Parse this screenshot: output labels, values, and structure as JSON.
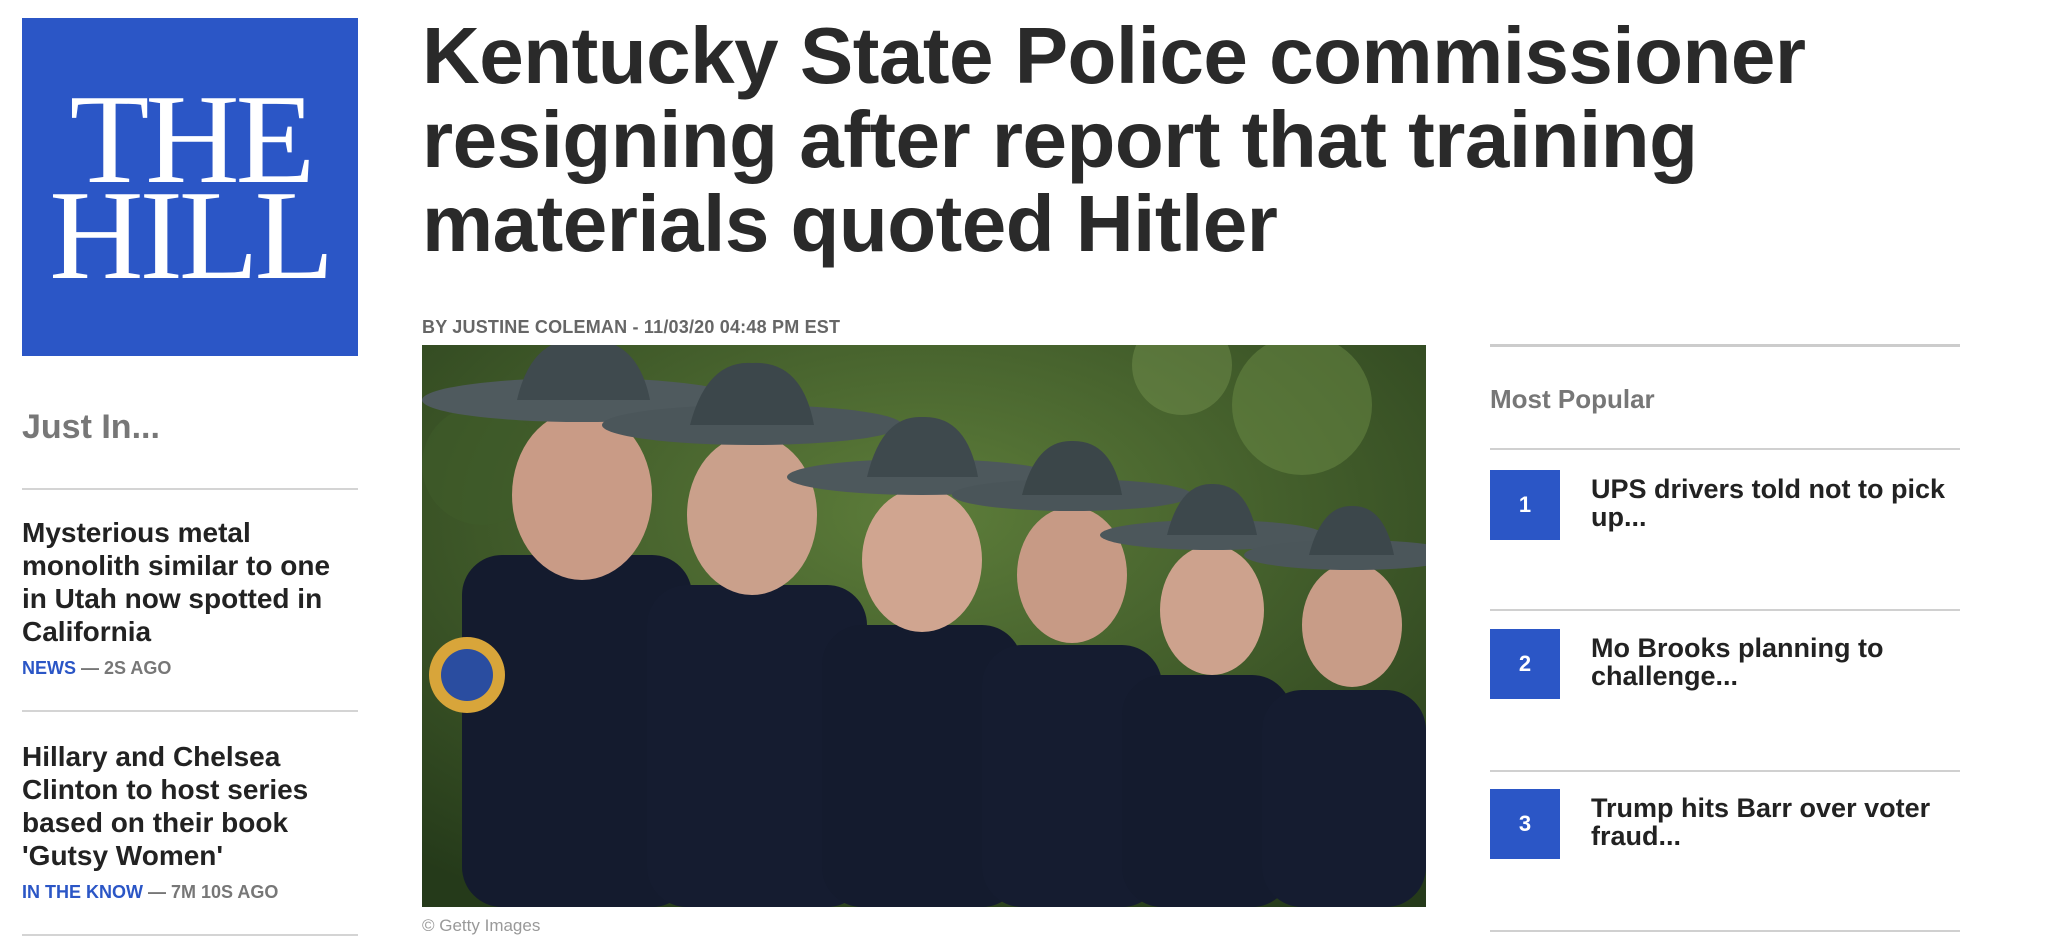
{
  "brand": {
    "logo_line1": "THE",
    "logo_line2": "HILL",
    "brand_color": "#2b56c6"
  },
  "article": {
    "headline": "Kentucky State Police commissioner resigning after report that training materials quoted Hitler",
    "byline": "BY JUSTINE COLEMAN - 11/03/20 04:48 PM EST",
    "image_credit": "© Getty Images"
  },
  "just_in": {
    "title": "Just In...",
    "items": [
      {
        "headline": "Mysterious metal monolith similar to one in Utah now spotted in California",
        "category": "NEWS",
        "time": "— 2S AGO"
      },
      {
        "headline": "Hillary and Chelsea Clinton to host series based on their book 'Gutsy Women'",
        "category": "IN THE KNOW",
        "time": "— 7M 10S AGO"
      }
    ]
  },
  "most_popular": {
    "title": "Most Popular",
    "items": [
      {
        "rank": "1",
        "text": "UPS drivers told not to pick up..."
      },
      {
        "rank": "2",
        "text": "Mo Brooks planning to challenge..."
      },
      {
        "rank": "3",
        "text": "Trump hits Barr over voter fraud..."
      }
    ]
  }
}
